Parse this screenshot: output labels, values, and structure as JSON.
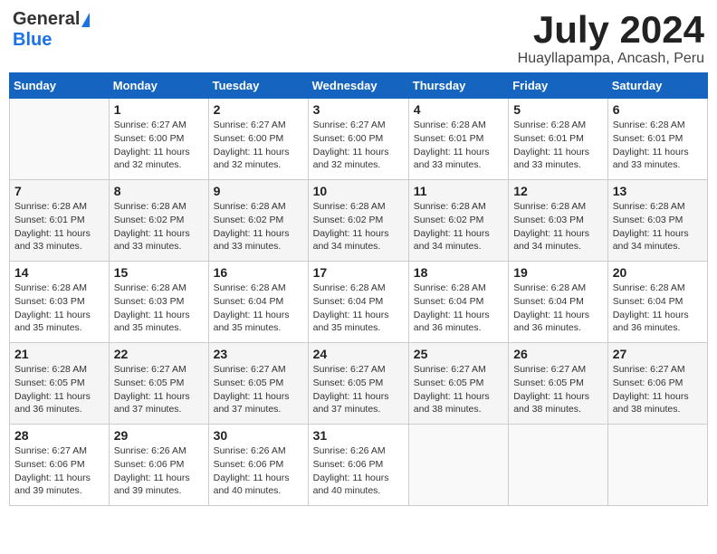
{
  "header": {
    "logo_general": "General",
    "logo_blue": "Blue",
    "title": "July 2024",
    "location": "Huayllapampa, Ancash, Peru"
  },
  "columns": [
    "Sunday",
    "Monday",
    "Tuesday",
    "Wednesday",
    "Thursday",
    "Friday",
    "Saturday"
  ],
  "weeks": [
    [
      {
        "day": "",
        "info": ""
      },
      {
        "day": "1",
        "info": "Sunrise: 6:27 AM\nSunset: 6:00 PM\nDaylight: 11 hours\nand 32 minutes."
      },
      {
        "day": "2",
        "info": "Sunrise: 6:27 AM\nSunset: 6:00 PM\nDaylight: 11 hours\nand 32 minutes."
      },
      {
        "day": "3",
        "info": "Sunrise: 6:27 AM\nSunset: 6:00 PM\nDaylight: 11 hours\nand 32 minutes."
      },
      {
        "day": "4",
        "info": "Sunrise: 6:28 AM\nSunset: 6:01 PM\nDaylight: 11 hours\nand 33 minutes."
      },
      {
        "day": "5",
        "info": "Sunrise: 6:28 AM\nSunset: 6:01 PM\nDaylight: 11 hours\nand 33 minutes."
      },
      {
        "day": "6",
        "info": "Sunrise: 6:28 AM\nSunset: 6:01 PM\nDaylight: 11 hours\nand 33 minutes."
      }
    ],
    [
      {
        "day": "7",
        "info": "Sunrise: 6:28 AM\nSunset: 6:01 PM\nDaylight: 11 hours\nand 33 minutes."
      },
      {
        "day": "8",
        "info": "Sunrise: 6:28 AM\nSunset: 6:02 PM\nDaylight: 11 hours\nand 33 minutes."
      },
      {
        "day": "9",
        "info": "Sunrise: 6:28 AM\nSunset: 6:02 PM\nDaylight: 11 hours\nand 33 minutes."
      },
      {
        "day": "10",
        "info": "Sunrise: 6:28 AM\nSunset: 6:02 PM\nDaylight: 11 hours\nand 34 minutes."
      },
      {
        "day": "11",
        "info": "Sunrise: 6:28 AM\nSunset: 6:02 PM\nDaylight: 11 hours\nand 34 minutes."
      },
      {
        "day": "12",
        "info": "Sunrise: 6:28 AM\nSunset: 6:03 PM\nDaylight: 11 hours\nand 34 minutes."
      },
      {
        "day": "13",
        "info": "Sunrise: 6:28 AM\nSunset: 6:03 PM\nDaylight: 11 hours\nand 34 minutes."
      }
    ],
    [
      {
        "day": "14",
        "info": "Sunrise: 6:28 AM\nSunset: 6:03 PM\nDaylight: 11 hours\nand 35 minutes."
      },
      {
        "day": "15",
        "info": "Sunrise: 6:28 AM\nSunset: 6:03 PM\nDaylight: 11 hours\nand 35 minutes."
      },
      {
        "day": "16",
        "info": "Sunrise: 6:28 AM\nSunset: 6:04 PM\nDaylight: 11 hours\nand 35 minutes."
      },
      {
        "day": "17",
        "info": "Sunrise: 6:28 AM\nSunset: 6:04 PM\nDaylight: 11 hours\nand 35 minutes."
      },
      {
        "day": "18",
        "info": "Sunrise: 6:28 AM\nSunset: 6:04 PM\nDaylight: 11 hours\nand 36 minutes."
      },
      {
        "day": "19",
        "info": "Sunrise: 6:28 AM\nSunset: 6:04 PM\nDaylight: 11 hours\nand 36 minutes."
      },
      {
        "day": "20",
        "info": "Sunrise: 6:28 AM\nSunset: 6:04 PM\nDaylight: 11 hours\nand 36 minutes."
      }
    ],
    [
      {
        "day": "21",
        "info": "Sunrise: 6:28 AM\nSunset: 6:05 PM\nDaylight: 11 hours\nand 36 minutes."
      },
      {
        "day": "22",
        "info": "Sunrise: 6:27 AM\nSunset: 6:05 PM\nDaylight: 11 hours\nand 37 minutes."
      },
      {
        "day": "23",
        "info": "Sunrise: 6:27 AM\nSunset: 6:05 PM\nDaylight: 11 hours\nand 37 minutes."
      },
      {
        "day": "24",
        "info": "Sunrise: 6:27 AM\nSunset: 6:05 PM\nDaylight: 11 hours\nand 37 minutes."
      },
      {
        "day": "25",
        "info": "Sunrise: 6:27 AM\nSunset: 6:05 PM\nDaylight: 11 hours\nand 38 minutes."
      },
      {
        "day": "26",
        "info": "Sunrise: 6:27 AM\nSunset: 6:05 PM\nDaylight: 11 hours\nand 38 minutes."
      },
      {
        "day": "27",
        "info": "Sunrise: 6:27 AM\nSunset: 6:06 PM\nDaylight: 11 hours\nand 38 minutes."
      }
    ],
    [
      {
        "day": "28",
        "info": "Sunrise: 6:27 AM\nSunset: 6:06 PM\nDaylight: 11 hours\nand 39 minutes."
      },
      {
        "day": "29",
        "info": "Sunrise: 6:26 AM\nSunset: 6:06 PM\nDaylight: 11 hours\nand 39 minutes."
      },
      {
        "day": "30",
        "info": "Sunrise: 6:26 AM\nSunset: 6:06 PM\nDaylight: 11 hours\nand 40 minutes."
      },
      {
        "day": "31",
        "info": "Sunrise: 6:26 AM\nSunset: 6:06 PM\nDaylight: 11 hours\nand 40 minutes."
      },
      {
        "day": "",
        "info": ""
      },
      {
        "day": "",
        "info": ""
      },
      {
        "day": "",
        "info": ""
      }
    ]
  ]
}
